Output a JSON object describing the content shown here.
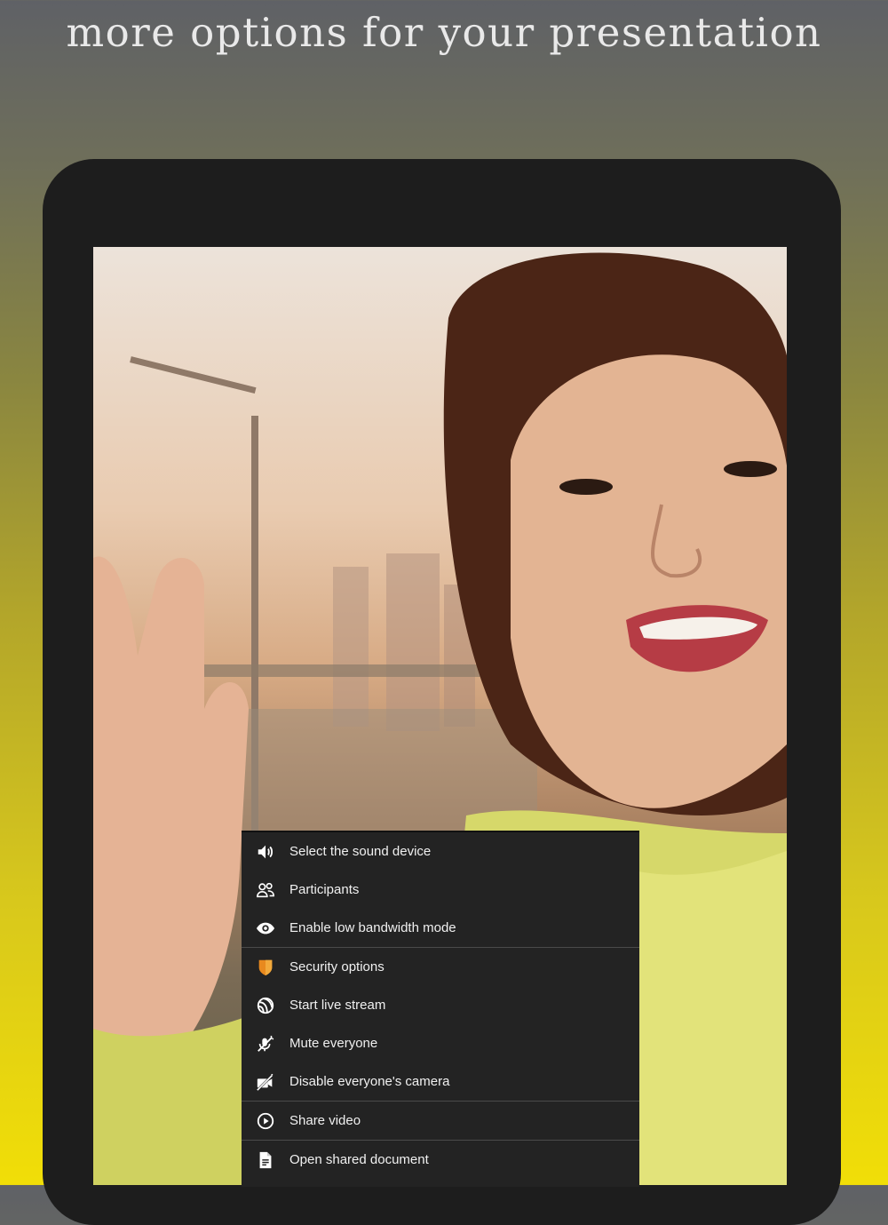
{
  "headline": "more options for your presentation",
  "menu": {
    "sections": [
      {
        "items": [
          {
            "label": "Select the sound device",
            "icon": "speaker-icon"
          },
          {
            "label": "Participants",
            "icon": "participants-icon"
          },
          {
            "label": "Enable low bandwidth mode",
            "icon": "eye-icon"
          }
        ]
      },
      {
        "items": [
          {
            "label": "Security options",
            "icon": "shield-icon"
          },
          {
            "label": "Start live stream",
            "icon": "live-stream-icon"
          },
          {
            "label": "Mute everyone",
            "icon": "mic-off-icon"
          },
          {
            "label": "Disable everyone's camera",
            "icon": "camera-off-icon"
          }
        ]
      },
      {
        "items": [
          {
            "label": "Share video",
            "icon": "play-circle-icon"
          }
        ]
      },
      {
        "items": [
          {
            "label": "Open shared document",
            "icon": "document-icon"
          }
        ]
      }
    ]
  },
  "colors": {
    "menu_bg": "#232323",
    "shield_accent": "#e8891e",
    "bg_top": "#5f6166",
    "bg_bottom": "#f1de07"
  }
}
